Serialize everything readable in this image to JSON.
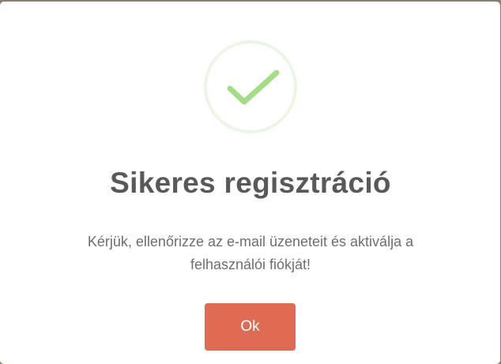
{
  "dialog": {
    "icon": "success-checkmark-icon",
    "title": "Sikeres regisztráció",
    "message_line1": "Kérjük, ellenőrizze az e-mail üzeneteit és aktiválja a",
    "message_line2": "felhasználói fiókját!",
    "ok_label": "Ok"
  },
  "colors": {
    "accent_button": "#e06b55",
    "success_green": "#a5dc86",
    "title_text": "#595959"
  }
}
